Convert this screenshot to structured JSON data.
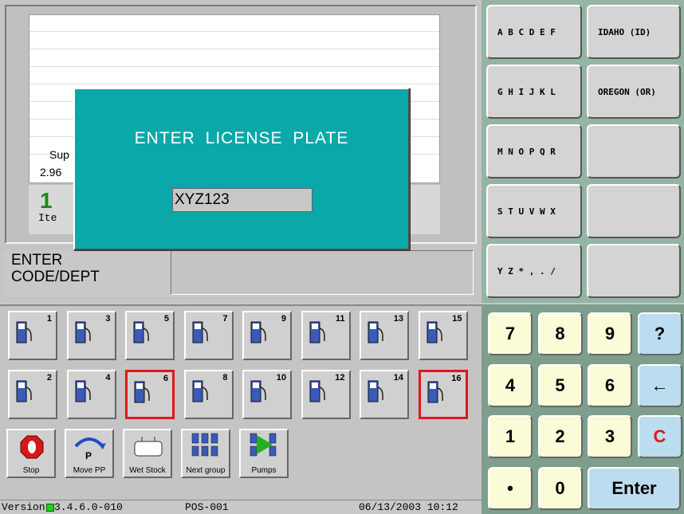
{
  "receipt": {
    "line_prefix": "Sup",
    "price_prefix": "2.96",
    "item_count": "1",
    "item_label": "Ite",
    "trailing": "e"
  },
  "modal": {
    "title": "ENTER LICENSE PLATE",
    "plate_value": "XYZ123"
  },
  "prompt": {
    "label_line1": "ENTER",
    "label_line2": "CODE/DEPT"
  },
  "pumps": [
    {
      "num": "1",
      "selected": false
    },
    {
      "num": "3",
      "selected": false
    },
    {
      "num": "5",
      "selected": false
    },
    {
      "num": "7",
      "selected": false
    },
    {
      "num": "9",
      "selected": false
    },
    {
      "num": "11",
      "selected": false
    },
    {
      "num": "13",
      "selected": false
    },
    {
      "num": "15",
      "selected": false
    },
    {
      "num": "2",
      "selected": false
    },
    {
      "num": "4",
      "selected": false
    },
    {
      "num": "6",
      "selected": true
    },
    {
      "num": "8",
      "selected": false
    },
    {
      "num": "10",
      "selected": false
    },
    {
      "num": "12",
      "selected": false
    },
    {
      "num": "14",
      "selected": false
    },
    {
      "num": "16",
      "selected": true
    }
  ],
  "function_buttons": [
    {
      "label": "Stop",
      "icon": "stop-icon"
    },
    {
      "label": "Move PP",
      "icon": "move-pp-icon"
    },
    {
      "label": "Wet Stock",
      "icon": "wet-stock-icon"
    },
    {
      "label": "Next group",
      "icon": "next-group-icon"
    },
    {
      "label": "Pumps",
      "icon": "pumps-icon"
    }
  ],
  "status": {
    "version": "Version",
    "version_number": "3.4.6.0-010",
    "pos": "POS-001",
    "datetime": "06/13/2003 10:12"
  },
  "alpha_keys": [
    "A B C D E F",
    "G H I J K L",
    "M N O P Q R",
    "S T U V W X",
    "Y Z * , . /"
  ],
  "state_keys": [
    "IDAHO (ID)",
    "OREGON (OR)",
    "",
    "",
    ""
  ],
  "numpad": [
    "7",
    "8",
    "9",
    "?",
    "4",
    "5",
    "6",
    "←",
    "1",
    "2",
    "3",
    "C",
    "•",
    "0",
    "Enter"
  ],
  "colors": {
    "modal": "#0aa8a8",
    "clear_key": "#e01818",
    "numpad_key": "#fbfbd8",
    "action_key": "#bcdcf0",
    "selected_pump": "#e01818"
  }
}
